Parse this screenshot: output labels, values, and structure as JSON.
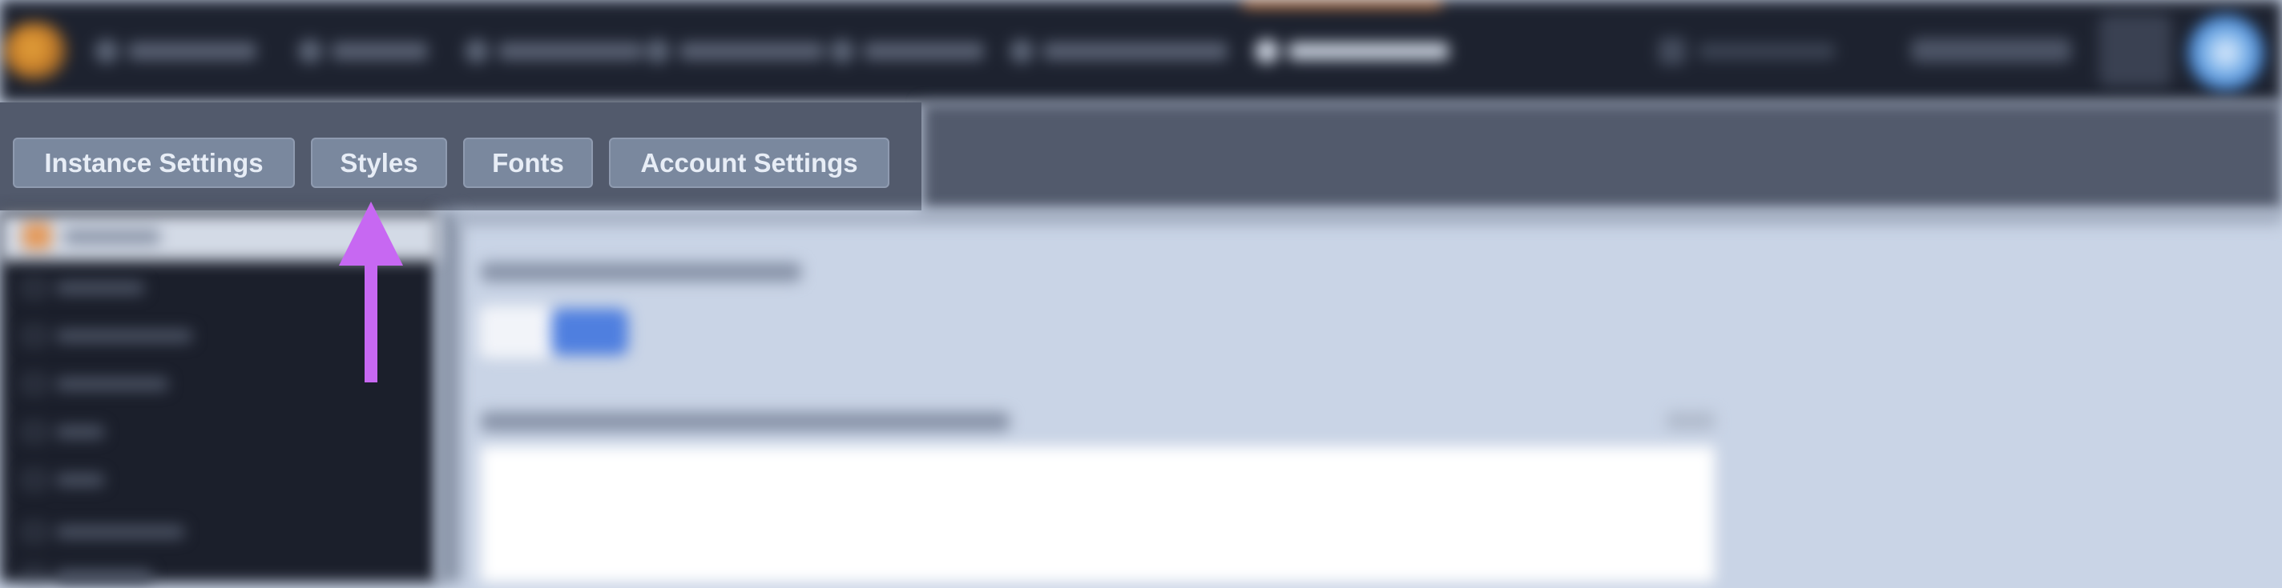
{
  "nav": {
    "logo": "app-logo",
    "items": [
      {
        "label": "",
        "icon": "dashboard-icon"
      },
      {
        "label": "",
        "icon": "users-icon"
      },
      {
        "label": "",
        "icon": "devices-icon"
      },
      {
        "label": "",
        "icon": "rooms-icon"
      },
      {
        "label": "",
        "icon": "reports-icon"
      },
      {
        "label": "",
        "icon": "learning-icon"
      },
      {
        "label": "",
        "icon": "settings-icon",
        "active": true
      }
    ],
    "right_link_icon": "link-icon",
    "user_name": "",
    "avatar": "user-avatar"
  },
  "subnav": {
    "tabs": [
      {
        "label": "Instance Settings"
      },
      {
        "label": "Styles"
      },
      {
        "label": "Fonts"
      },
      {
        "label": "Account Settings"
      }
    ]
  },
  "sidebar": {
    "header": {
      "icon": "folder-icon",
      "label": ""
    },
    "items": [
      "",
      "",
      "",
      "",
      "",
      "",
      ""
    ]
  },
  "main": {
    "theme_label": "",
    "toggle_options": [
      "",
      ""
    ],
    "css_label": "",
    "css_value": ""
  },
  "colors": {
    "nav_bg": "#1d222f",
    "subbar_bg": "#525a6c",
    "tab_bg": "#7a889e",
    "tab_text": "#e7edf6",
    "content_bg": "#c9d4e6",
    "sidebar_bg": "#1b1f2b",
    "toggle_active": "#4f7fdf",
    "annotation_arrow": "#c768f2",
    "active_nav_accent": "#c0723a"
  }
}
